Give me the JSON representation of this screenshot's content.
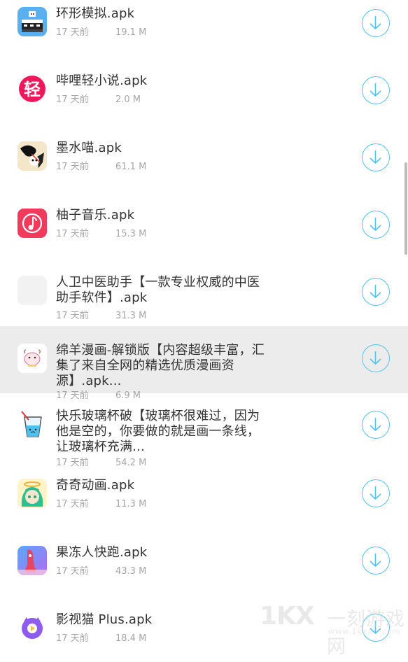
{
  "files": [
    {
      "icon": "pixel-train-app-icon",
      "title": "环形模拟.apk",
      "date": "17 天前",
      "size": "19.1 M"
    },
    {
      "icon": "bilibili-light-novel-app-icon",
      "title": "哔哩轻小说.apk",
      "date": "17 天前",
      "size": "2.0 M"
    },
    {
      "icon": "ink-cat-app-icon",
      "title": "墨水喵.apk",
      "date": "17 天前",
      "size": "61.1 M"
    },
    {
      "icon": "music-note-app-icon",
      "title": "柚子音乐.apk",
      "date": "17 天前",
      "size": "15.3 M"
    },
    {
      "icon": "blank-app-icon",
      "title": "人卫中医助手【一款专业权威的中医助手软件】.apk",
      "date": "17 天前",
      "size": "31.3 M"
    },
    {
      "icon": "sheep-comic-app-icon",
      "title": "绵羊漫画-解锁版【内容超级丰富，汇集了来自全网的精选优质漫画资源】.apk...",
      "date": "17 天前",
      "size": "6.9 M",
      "highlighted": true
    },
    {
      "icon": "water-glass-app-icon",
      "title": "快乐玻璃杯破【玻璃杯很难过，因为他是空的，你要做的就是画一条线，让玻璃杯充满...",
      "date": "17 天前",
      "size": "54.2 M"
    },
    {
      "icon": "anime-girl-app-icon",
      "title": "奇奇动画.apk",
      "date": "17 天前",
      "size": "11.3 M"
    },
    {
      "icon": "jelly-runner-app-icon",
      "title": "果冻人快跑.apk",
      "date": "17 天前",
      "size": "43.3 M"
    },
    {
      "icon": "video-cat-app-icon",
      "title": "影视猫 Plus.apk",
      "date": "17 天前",
      "size": "18.4 M"
    }
  ],
  "watermark": {
    "logo": "1KX",
    "name": "一刻游戏网",
    "url": "www.1kxun.com"
  },
  "colors": {
    "accent": "#56c3ea",
    "title": "#333333",
    "meta": "#a6a6a6",
    "highlight": "#ececec"
  }
}
